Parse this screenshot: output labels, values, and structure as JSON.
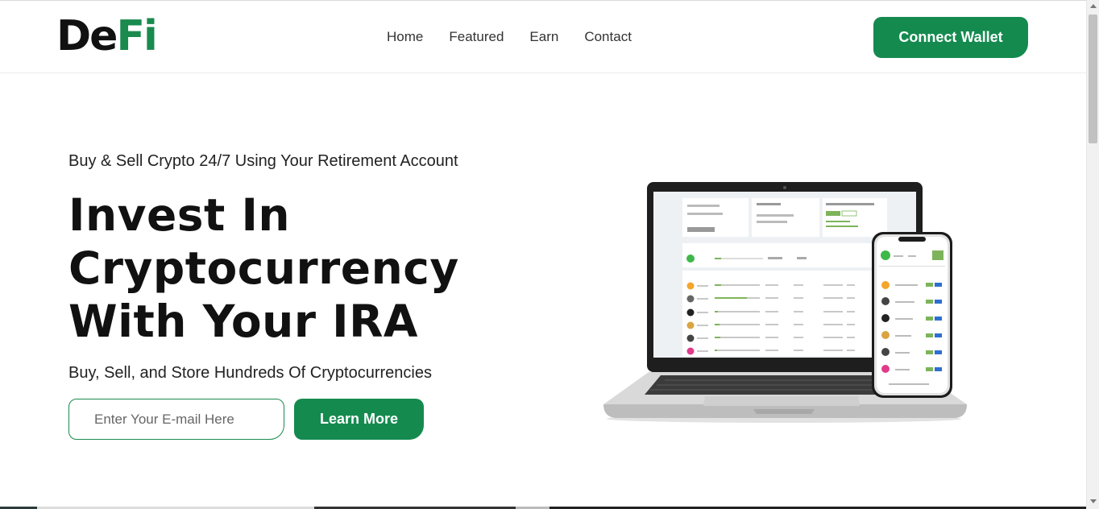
{
  "header": {
    "logo_part1": "De",
    "logo_part2": "Fi",
    "nav": [
      "Home",
      "Featured",
      "Earn",
      "Contact"
    ],
    "connect_label": "Connect Wallet"
  },
  "hero": {
    "tagline": "Buy & Sell Crypto 24/7 Using Your Retirement Account",
    "headline_lines": [
      "Invest In",
      "Cryptocurrency",
      "With Your IRA"
    ],
    "subtext": "Buy, Sell, and Store Hundreds Of Cryptocurrencies",
    "email_placeholder": "Enter Your E-mail Here",
    "learn_more_label": "Learn More"
  },
  "colors": {
    "brand_green": "#158a4f"
  }
}
